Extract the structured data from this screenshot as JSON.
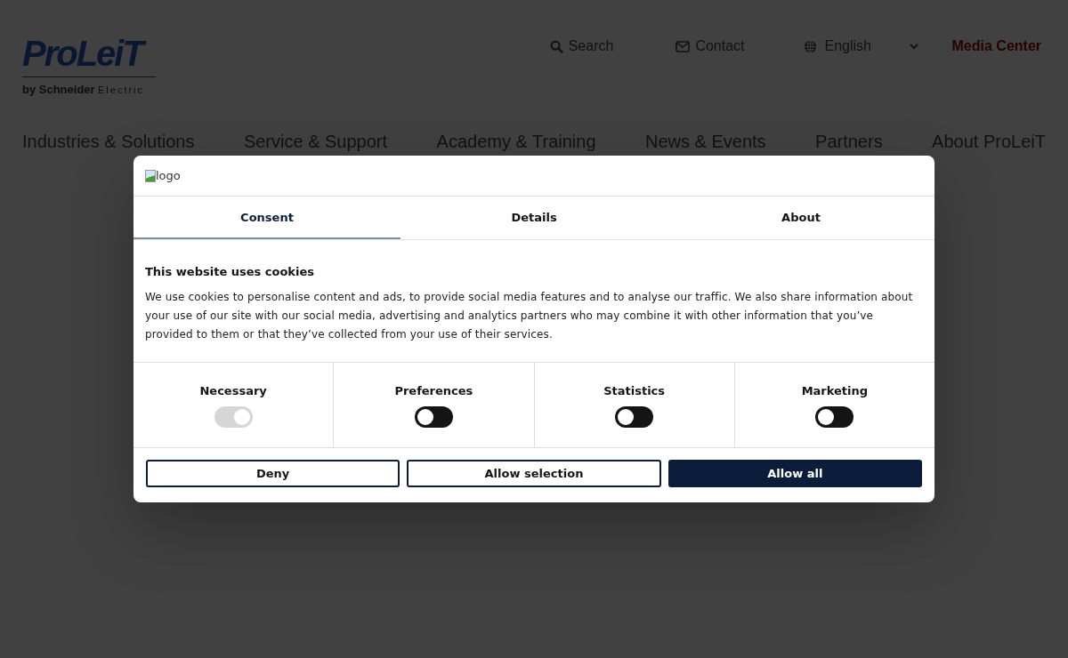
{
  "header": {
    "logo": {
      "name": "ProLeiT",
      "tagline_bold": "by Schneider",
      "tagline": "Electric"
    },
    "top_links": [
      {
        "kind": "search",
        "label": "Search"
      },
      {
        "kind": "contact",
        "label": "Contact"
      },
      {
        "kind": "language",
        "label": "English"
      },
      {
        "kind": "highlight",
        "label": "Media Center"
      }
    ],
    "nav": [
      "Industries & Solutions",
      "Service & Support",
      "Academy & Training",
      "News & Events",
      "Partners",
      "About ProLeiT"
    ]
  },
  "cookie_dialog": {
    "logo_alt": "logo",
    "tabs": [
      {
        "label": "Consent",
        "selected": true
      },
      {
        "label": "Details",
        "selected": false
      },
      {
        "label": "About",
        "selected": false
      }
    ],
    "title": "This website uses cookies",
    "text": "We use cookies to personalise content and ads, to provide social media features and to analyse our traffic. We also share information about your use of our site with our social media, advertising and analytics partners who may combine it with other information that you’ve provided to them or that they’ve collected from your use of their services.",
    "categories": [
      {
        "label": "Necessary",
        "on": true,
        "disabled": true
      },
      {
        "label": "Preferences",
        "on": false,
        "disabled": false
      },
      {
        "label": "Statistics",
        "on": false,
        "disabled": false
      },
      {
        "label": "Marketing",
        "on": false,
        "disabled": false
      }
    ],
    "buttons": [
      {
        "label": "Deny",
        "kind": "outline"
      },
      {
        "label": "Allow selection",
        "kind": "outline"
      },
      {
        "label": "Allow all",
        "kind": "filled"
      }
    ]
  }
}
